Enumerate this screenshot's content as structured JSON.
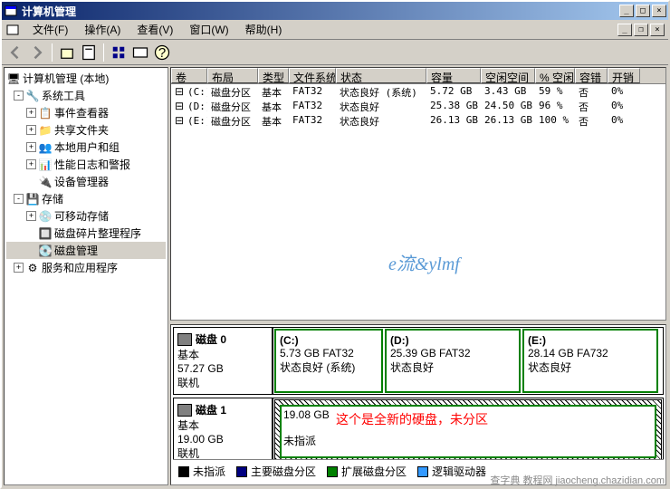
{
  "title": "计算机管理",
  "menubar": [
    "文件(F)",
    "操作(A)",
    "查看(V)",
    "窗口(W)",
    "帮助(H)"
  ],
  "tree": {
    "root": "计算机管理 (本地)",
    "n1": "系统工具",
    "n1a": "事件查看器",
    "n1b": "共享文件夹",
    "n1c": "本地用户和组",
    "n1d": "性能日志和警报",
    "n1e": "设备管理器",
    "n2": "存储",
    "n2a": "可移动存储",
    "n2b": "磁盘碎片整理程序",
    "n2c": "磁盘管理",
    "n3": "服务和应用程序"
  },
  "headers": {
    "vol": "卷",
    "lay": "布局",
    "typ": "类型",
    "fs": "文件系统",
    "st": "状态",
    "cap": "容量",
    "fr": "空闲空间",
    "pct": "% 空闲",
    "ft": "容错",
    "oh": "开销"
  },
  "volumes": [
    {
      "vol": "(C:)",
      "lay": "磁盘分区",
      "typ": "基本",
      "fs": "FAT32",
      "st": "状态良好 (系统)",
      "cap": "5.72 GB",
      "fr": "3.43 GB",
      "pct": "59 %",
      "ft": "否",
      "oh": "0%"
    },
    {
      "vol": "(D:)",
      "lay": "磁盘分区",
      "typ": "基本",
      "fs": "FAT32",
      "st": "状态良好",
      "cap": "25.38 GB",
      "fr": "24.50 GB",
      "pct": "96 %",
      "ft": "否",
      "oh": "0%"
    },
    {
      "vol": "(E:)",
      "lay": "磁盘分区",
      "typ": "基本",
      "fs": "FAT32",
      "st": "状态良好",
      "cap": "26.13 GB",
      "fr": "26.13 GB",
      "pct": "100 %",
      "ft": "否",
      "oh": "0%"
    }
  ],
  "watermark": "e流&ylmf",
  "disks": [
    {
      "name": "磁盘 0",
      "type": "基本",
      "size": "57.27 GB",
      "status": "联机",
      "parts": [
        {
          "label": "(C:)",
          "info": "5.73 GB FAT32",
          "status": "状态良好 (系统)",
          "w": 120
        },
        {
          "label": "(D:)",
          "info": "25.39 GB FAT32",
          "status": "状态良好",
          "w": 150
        },
        {
          "label": "(E:)",
          "info": "28.14 GB FA732",
          "status": "状态良好",
          "w": 150
        }
      ]
    },
    {
      "name": "磁盘 1",
      "type": "基本",
      "size": "19.00 GB",
      "status": "联机",
      "unalloc": {
        "info": "19.08 GB",
        "status": "未指派"
      }
    }
  ],
  "annotation": "这个是全新的硬盘，未分区",
  "legend": [
    {
      "color": "#000000",
      "label": "未指派"
    },
    {
      "color": "#000080",
      "label": "主要磁盘分区"
    },
    {
      "color": "#008000",
      "label": "扩展磁盘分区"
    },
    {
      "color": "#3399ff",
      "label": "逻辑驱动器"
    }
  ],
  "footer": "查字典 教程网\njiaocheng.chazidian.com"
}
